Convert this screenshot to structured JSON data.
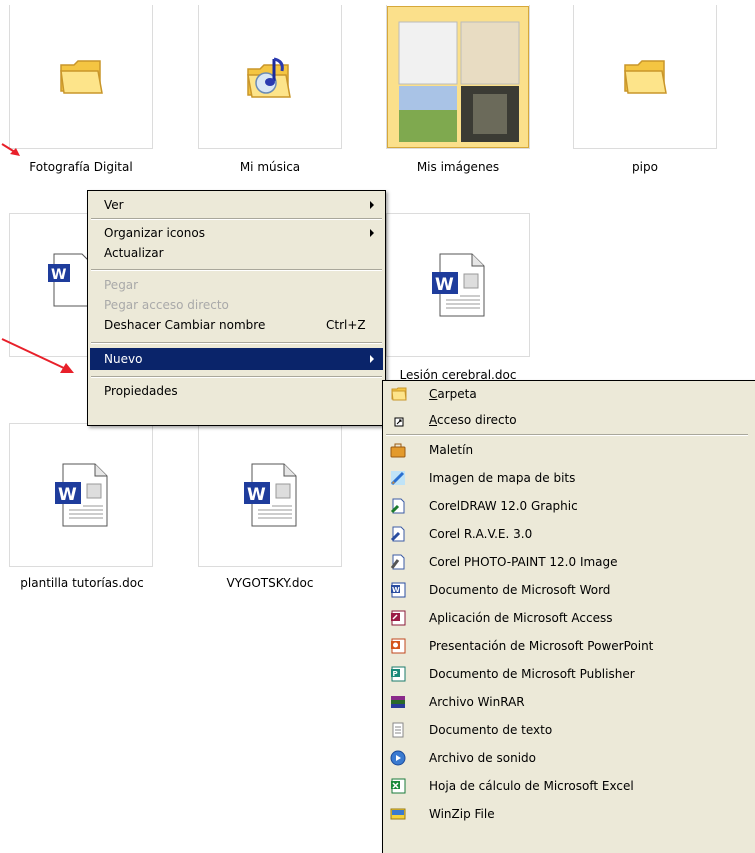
{
  "files": [
    {
      "name": "Fotografía Digital",
      "icon": "folder-icon"
    },
    {
      "name": "Mi música",
      "icon": "music-folder-icon"
    },
    {
      "name": "Mis imágenes",
      "icon": "pictures-folder-icon"
    },
    {
      "name": "pipo",
      "icon": "folder-icon"
    },
    {
      "name": "Lesión cerebral.doc",
      "icon": "word-document-icon"
    },
    {
      "name": "plantilla tutorías.doc",
      "icon": "word-document-icon"
    },
    {
      "name": "VYGOTSKY.doc",
      "icon": "word-document-icon"
    }
  ],
  "context_menu": {
    "items": [
      {
        "label": "Ver",
        "submenu": true
      },
      {
        "label": "Organizar iconos",
        "submenu": true
      },
      {
        "label": "Actualizar"
      },
      {
        "label": "Pegar",
        "disabled": true
      },
      {
        "label": "Pegar acceso directo",
        "disabled": true
      },
      {
        "label": "Deshacer Cambiar nombre",
        "shortcut": "Ctrl+Z"
      },
      {
        "label": "Nuevo",
        "submenu": true,
        "highlighted": true
      },
      {
        "label": "Propiedades"
      }
    ]
  },
  "new_submenu": {
    "items": [
      {
        "label_accel": "C",
        "label_rest": "arpeta",
        "icon": "folder-icon"
      },
      {
        "label_accel": "A",
        "label_rest": "cceso directo",
        "icon": "shortcut-icon"
      },
      {
        "label": "Maletín",
        "icon": "briefcase-icon"
      },
      {
        "label": "Imagen de mapa de bits",
        "icon": "bitmap-icon"
      },
      {
        "label": "CorelDRAW 12.0 Graphic",
        "icon": "coreldraw-icon"
      },
      {
        "label": "Corel R.A.V.E. 3.0",
        "icon": "corel-rave-icon"
      },
      {
        "label": "Corel PHOTO-PAINT 12.0 Image",
        "icon": "photo-paint-icon"
      },
      {
        "label": "Documento de Microsoft Word",
        "icon": "word-icon"
      },
      {
        "label": "Aplicación de Microsoft Access",
        "icon": "access-icon"
      },
      {
        "label": "Presentación de Microsoft PowerPoint",
        "icon": "powerpoint-icon"
      },
      {
        "label": "Documento de Microsoft Publisher",
        "icon": "publisher-icon"
      },
      {
        "label": "Archivo WinRAR",
        "icon": "winrar-icon"
      },
      {
        "label": "Documento de texto",
        "icon": "text-document-icon"
      },
      {
        "label": "Archivo de sonido",
        "icon": "sound-file-icon"
      },
      {
        "label": "Hoja de cálculo de Microsoft Excel",
        "icon": "excel-icon"
      },
      {
        "label": "WinZip File",
        "icon": "winzip-icon"
      }
    ]
  },
  "colors": {
    "highlight": "#0a246a",
    "menu_bg": "#ece9d8",
    "disabled_text": "#a9a9a9",
    "annotation_arrow": "#e8202a"
  }
}
